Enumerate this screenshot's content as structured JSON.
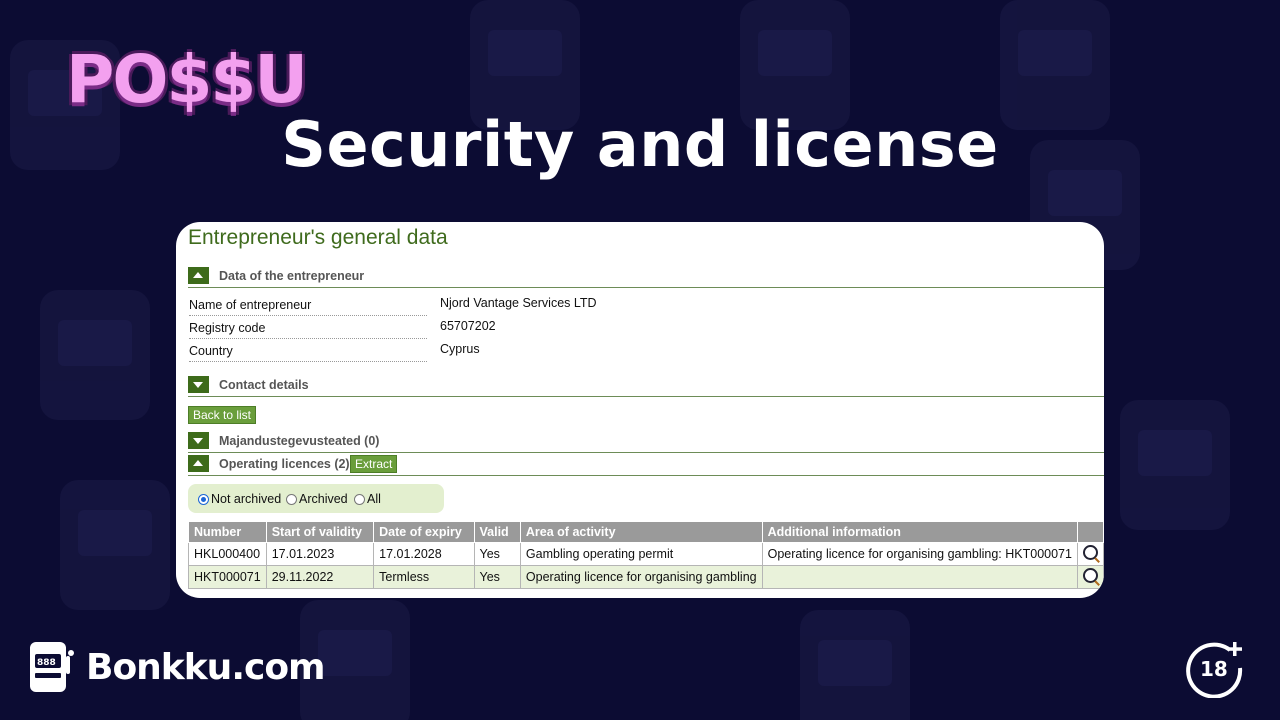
{
  "logo": {
    "text": "PO$$U"
  },
  "page": {
    "title": "Security and license"
  },
  "card": {
    "title": "Entrepreneur's general data",
    "sections": {
      "entrepreneur": "Data of the entrepreneur",
      "contact": "Contact details",
      "economic": "Majandustegevusteated (0)",
      "licences": "Operating licences (2)"
    },
    "fields": [
      {
        "label": "Name of entrepreneur",
        "value": "Njord Vantage Services LTD"
      },
      {
        "label": "Registry code",
        "value": "65707202"
      },
      {
        "label": "Country",
        "value": "Cyprus"
      }
    ],
    "back_button": "Back to list",
    "extract_button": "Extract",
    "filters": {
      "not_archived": "Not archived",
      "archived": "Archived",
      "all": "All",
      "selected": "Not archived"
    },
    "table": {
      "headers": [
        "Number",
        "Start of validity",
        "Date of expiry",
        "Valid",
        "Area of activity",
        "Additional information"
      ],
      "rows": [
        [
          "HKL000400",
          "17.01.2023",
          "17.01.2028",
          "Yes",
          "Gambling operating permit",
          "Operating licence for organising gambling: HKT000071"
        ],
        [
          "HKT000071",
          "29.11.2022",
          "Termless",
          "Yes",
          "Operating licence for organising gambling",
          ""
        ]
      ]
    }
  },
  "footer": {
    "brand": "Bonkku.com",
    "age_badge": "18"
  },
  "colors": {
    "background": "#0c0c33",
    "accent_green": "#3d6b1a",
    "logo_pink": "#f3a0ef"
  }
}
